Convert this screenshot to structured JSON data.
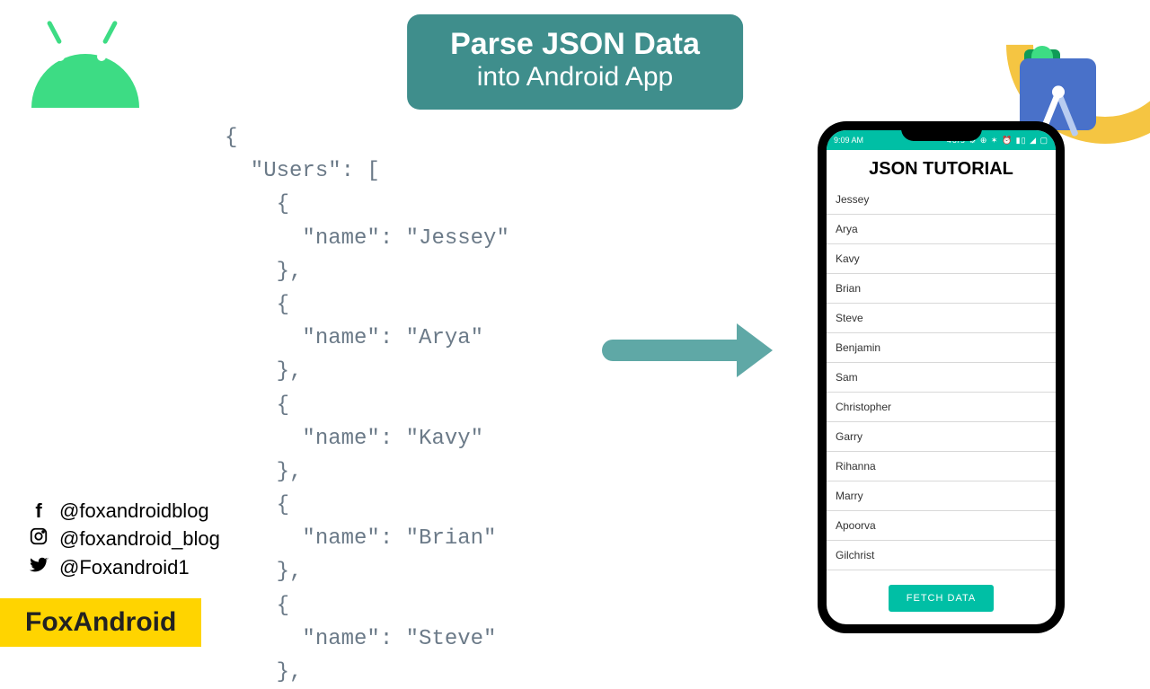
{
  "banner": {
    "title": "Parse JSON Data",
    "subtitle": "into Android App"
  },
  "code": "{\n  \"Users\": [\n    {\n      \"name\": \"Jessey\"\n    },\n    {\n      \"name\": \"Arya\"\n    },\n    {\n      \"name\": \"Kavy\"\n    },\n    {\n      \"name\": \"Brian\"\n    },\n    {\n      \"name\": \"Steve\"\n    },",
  "phone": {
    "status_time": "9:09 AM",
    "status_right": "46/s ⚙ ⊕ ✶ ⏰ ▮▯ ◢ ▢",
    "app_title": "JSON TUTORIAL",
    "list": [
      "Jessey",
      "Arya",
      "Kavy",
      "Brian",
      "Steve",
      "Benjamin",
      "Sam",
      "Christopher",
      "Garry",
      "Rihanna",
      "Marry",
      "Apoorva",
      "Gilchrist"
    ],
    "button": "FETCH DATA"
  },
  "socials": {
    "facebook": "@foxandroidblog",
    "instagram": "@foxandroid_blog",
    "twitter": "@Foxandroid1"
  },
  "brand": "FoxAndroid"
}
